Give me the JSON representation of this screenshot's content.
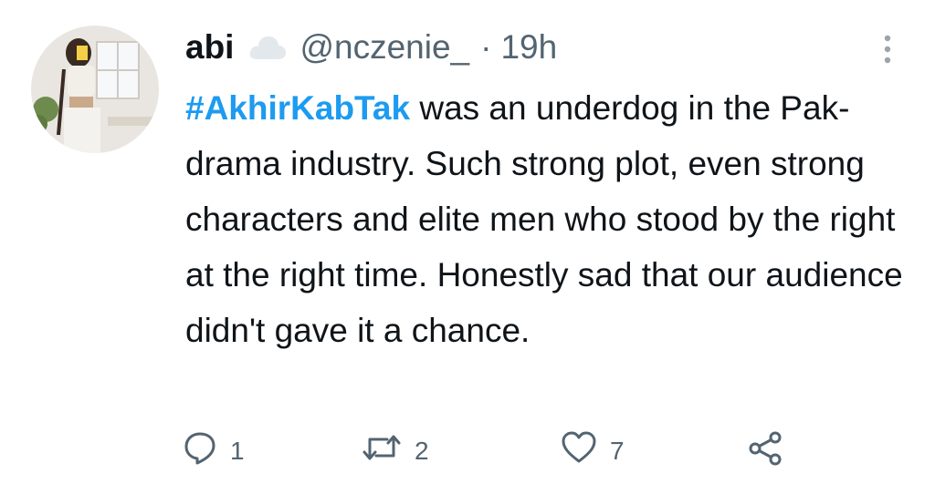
{
  "tweet": {
    "display_name": "abi",
    "handle": "@nczenie_",
    "separator": "·",
    "time": "19h",
    "hashtag": "#AkhirKabTak",
    "text": " was an underdog in the Pak-drama industry. Such strong plot, even strong characters and elite men who stood by the right at the right time. Honestly sad that our audience didn't gave it a chance.",
    "icons": {
      "verified_badge": "cloud-icon",
      "more": "more-vertical-icon",
      "reply": "reply-icon",
      "retweet": "retweet-icon",
      "like": "heart-icon",
      "share": "share-icon"
    },
    "stats": {
      "replies": "1",
      "retweets": "2",
      "likes": "7"
    },
    "colors": {
      "hashtag": "#1d9bf0",
      "secondary_text": "#536471",
      "primary_text": "#0f1419"
    }
  }
}
